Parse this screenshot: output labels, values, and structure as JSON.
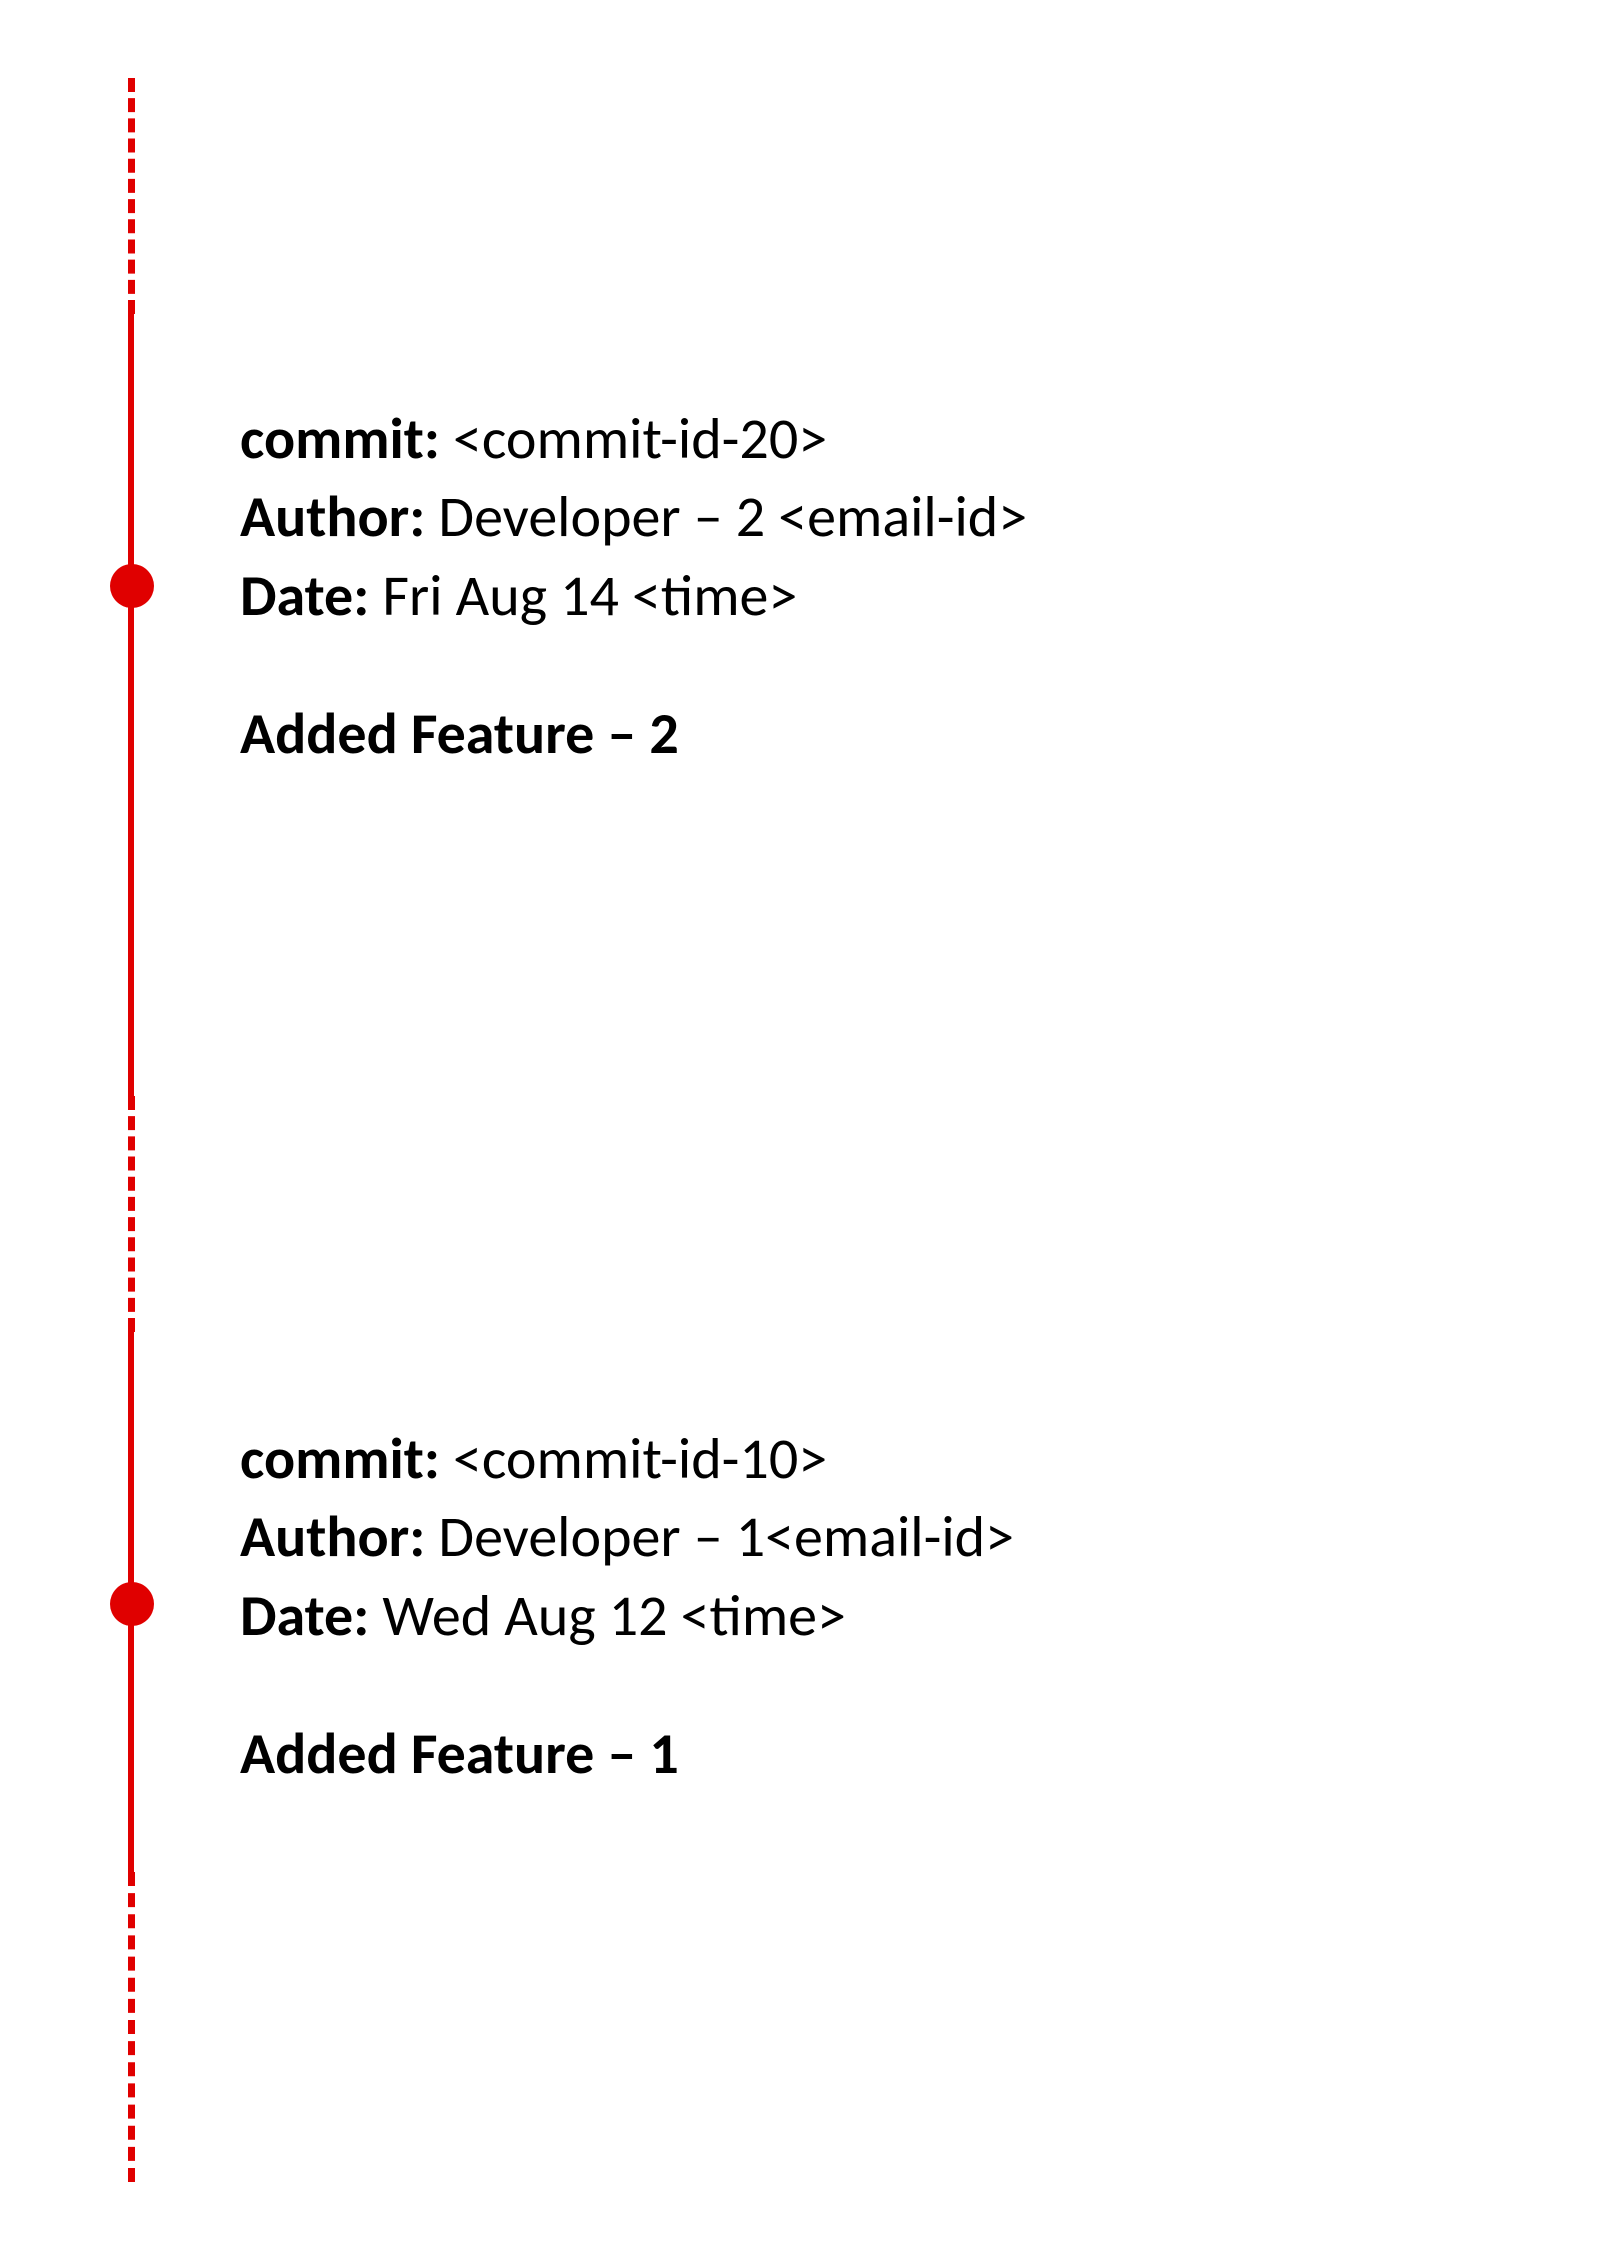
{
  "commits": [
    {
      "commit_label": "commit:",
      "commit_value": " <commit-id-20>",
      "author_label": "Author:",
      "author_value": " Developer – 2 <email-id>",
      "date_label": "Date:",
      "date_value": " Fri Aug 14 <time>",
      "message": "Added Feature – 2"
    },
    {
      "commit_label": "commit:",
      "commit_value": " <commit-id-10>",
      "author_label": "Author:",
      "author_value": " Developer – 1<email-id>",
      "date_label": "Date:",
      "date_value": " Wed Aug 12 <time>",
      "message": "Added Feature – 1"
    }
  ]
}
